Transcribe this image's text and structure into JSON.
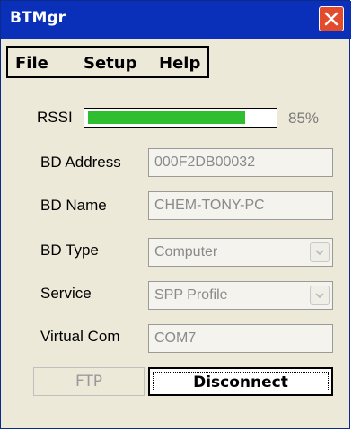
{
  "window": {
    "title": "BTMgr"
  },
  "menu": [
    "File",
    "Setup",
    "Help"
  ],
  "rssi": {
    "label": "RSSI",
    "percent": 85,
    "percent_text": "85%"
  },
  "fields": {
    "bd_address": {
      "label": "BD Address",
      "value": "000F2DB00032"
    },
    "bd_name": {
      "label": "BD Name",
      "value": "CHEM-TONY-PC"
    },
    "bd_type": {
      "label": "BD Type",
      "value": "Computer"
    },
    "service": {
      "label": "Service",
      "value": "SPP Profile"
    },
    "virtual_com": {
      "label": "Virtual Com",
      "value": "COM7"
    }
  },
  "buttons": {
    "ftp": "FTP",
    "disconnect": "Disconnect"
  },
  "colors": {
    "titlebar": "#0a2fb8",
    "progress_fill": "#2fbe2f",
    "close": "#e24b2c"
  },
  "icons": {
    "close": "close-icon",
    "dropdown": "chevron-down-icon"
  }
}
